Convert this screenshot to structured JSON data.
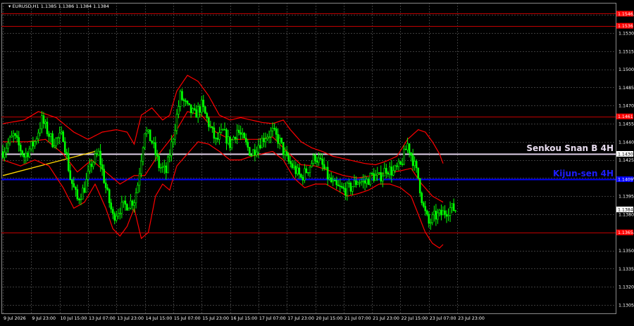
{
  "header": {
    "symbol": "EURUSD,H1",
    "ohlc": "1.1385 1.1386 1.1384 1.1384"
  },
  "colors": {
    "background": "#000000",
    "grid": "#3c3c3c",
    "candle": "#00ff00",
    "bollinger": "#ff0000",
    "resistance": "#c00000",
    "senkou": "#e0d0e8",
    "kijun": "#0000ff",
    "trendline": "#ffd700",
    "axis_text": "#ffffff",
    "price_label_bg": "#ffffff",
    "red_label_bg": "#ff0000"
  },
  "chart_data": {
    "type": "candlestick",
    "title": "",
    "ylim": [
      1.1298,
      1.1555
    ],
    "y_ticks": [
      "1.1545",
      "1.1530",
      "1.1515",
      "1.1500",
      "1.1485",
      "1.1470",
      "1.1455",
      "1.1440",
      "1.1425",
      "1.1410",
      "1.1395",
      "1.1380",
      "1.1365",
      "1.1350",
      "1.1335",
      "1.1320",
      "1.1305"
    ],
    "x_ticks": [
      "9 Jul 2026",
      "9 Jul 23:00",
      "10 Jul 15:00",
      "13 Jul 07:00",
      "13 Jul 23:00",
      "14 Jul 15:00",
      "15 Jul 07:00",
      "15 Jul 23:00",
      "16 Jul 15:00",
      "17 Jul 07:00",
      "17 Jul 23:00",
      "20 Jul 15:00",
      "21 Jul 07:00",
      "21 Jul 23:00",
      "22 Jul 15:00",
      "23 Jul 07:00",
      "23 Jul 23:00"
    ],
    "total_bars": 256,
    "current_price": 1.1384,
    "current_price_label": "1.1384",
    "levels": [
      {
        "price": 1.1546,
        "label": "1.1546",
        "kind": "resistance"
      },
      {
        "price": 1.1536,
        "label": "1.1536",
        "kind": "resistance"
      },
      {
        "price": 1.1461,
        "label": "1.1461",
        "kind": "resistance"
      },
      {
        "price": 1.143,
        "label": "1.1430",
        "kind": "senkou"
      },
      {
        "price": 1.1409,
        "label": "1.1409",
        "kind": "kijun"
      },
      {
        "price": 1.1365,
        "label": "1.1365",
        "kind": "resistance"
      }
    ],
    "annotations": [
      {
        "text": "Senkou Snan B 4H",
        "price": 1.143,
        "color": "#e8dcef"
      },
      {
        "text": "Kijun-sen 4H",
        "price": 1.1409,
        "color": "#1e1eff"
      }
    ],
    "trendline": {
      "from": {
        "bar": 0,
        "price": 1.1412
      },
      "to": {
        "bar": 52,
        "price": 1.1432
      }
    },
    "price_path": [
      [
        0,
        1.1432
      ],
      [
        6,
        1.1445
      ],
      [
        12,
        1.1428
      ],
      [
        18,
        1.144
      ],
      [
        22,
        1.1458
      ],
      [
        28,
        1.144
      ],
      [
        34,
        1.1445
      ],
      [
        38,
        1.141
      ],
      [
        42,
        1.1392
      ],
      [
        46,
        1.1402
      ],
      [
        50,
        1.1422
      ],
      [
        54,
        1.143
      ],
      [
        58,
        1.1402
      ],
      [
        62,
        1.1378
      ],
      [
        66,
        1.1385
      ],
      [
        70,
        1.1388
      ],
      [
        74,
        1.1392
      ],
      [
        76,
        1.1405
      ],
      [
        80,
        1.145
      ],
      [
        84,
        1.144
      ],
      [
        88,
        1.142
      ],
      [
        92,
        1.1415
      ],
      [
        96,
        1.1445
      ],
      [
        100,
        1.1478
      ],
      [
        104,
        1.1468
      ],
      [
        108,
        1.1462
      ],
      [
        112,
        1.147
      ],
      [
        116,
        1.1455
      ],
      [
        120,
        1.144
      ],
      [
        124,
        1.1448
      ],
      [
        128,
        1.1438
      ],
      [
        132,
        1.145
      ],
      [
        136,
        1.144
      ],
      [
        140,
        1.143
      ],
      [
        144,
        1.1438
      ],
      [
        148,
        1.1445
      ],
      [
        152,
        1.1448
      ],
      [
        156,
        1.144
      ],
      [
        160,
        1.1425
      ],
      [
        164,
        1.1418
      ],
      [
        168,
        1.141
      ],
      [
        172,
        1.1418
      ],
      [
        176,
        1.1428
      ],
      [
        180,
        1.142
      ],
      [
        184,
        1.1408
      ],
      [
        188,
        1.1402
      ],
      [
        192,
        1.14
      ],
      [
        196,
        1.1402
      ],
      [
        200,
        1.1408
      ],
      [
        204,
        1.1406
      ],
      [
        208,
        1.1412
      ],
      [
        212,
        1.141
      ],
      [
        216,
        1.1418
      ],
      [
        220,
        1.1415
      ],
      [
        224,
        1.142
      ],
      [
        228,
        1.1438
      ],
      [
        231,
        1.1425
      ],
      [
        234,
        1.141
      ],
      [
        237,
        1.1385
      ],
      [
        240,
        1.1372
      ],
      [
        243,
        1.1378
      ],
      [
        247,
        1.138
      ],
      [
        252,
        1.1385
      ],
      [
        255,
        1.1384
      ]
    ],
    "bollinger_upper": [
      [
        0,
        1.1455
      ],
      [
        12,
        1.1458
      ],
      [
        20,
        1.1465
      ],
      [
        30,
        1.146
      ],
      [
        40,
        1.1448
      ],
      [
        48,
        1.1442
      ],
      [
        56,
        1.1448
      ],
      [
        64,
        1.145
      ],
      [
        70,
        1.1448
      ],
      [
        74,
        1.1438
      ],
      [
        78,
        1.1462
      ],
      [
        84,
        1.1468
      ],
      [
        90,
        1.1458
      ],
      [
        94,
        1.1462
      ],
      [
        98,
        1.1482
      ],
      [
        104,
        1.1495
      ],
      [
        110,
        1.149
      ],
      [
        116,
        1.1478
      ],
      [
        122,
        1.1462
      ],
      [
        128,
        1.1458
      ],
      [
        134,
        1.146
      ],
      [
        140,
        1.1458
      ],
      [
        146,
        1.1456
      ],
      [
        152,
        1.1455
      ],
      [
        158,
        1.1458
      ],
      [
        162,
        1.145
      ],
      [
        168,
        1.144
      ],
      [
        174,
        1.1435
      ],
      [
        180,
        1.1432
      ],
      [
        186,
        1.1428
      ],
      [
        192,
        1.1426
      ],
      [
        198,
        1.1424
      ],
      [
        204,
        1.1422
      ],
      [
        210,
        1.1421
      ],
      [
        216,
        1.1424
      ],
      [
        222,
        1.1428
      ],
      [
        228,
        1.1442
      ],
      [
        234,
        1.145
      ],
      [
        238,
        1.1448
      ],
      [
        242,
        1.144
      ],
      [
        246,
        1.143
      ],
      [
        248,
        1.1422
      ]
    ],
    "bollinger_lower": [
      [
        0,
        1.1425
      ],
      [
        10,
        1.142
      ],
      [
        18,
        1.1425
      ],
      [
        26,
        1.142
      ],
      [
        34,
        1.1402
      ],
      [
        40,
        1.1385
      ],
      [
        46,
        1.139
      ],
      [
        52,
        1.1405
      ],
      [
        58,
        1.1385
      ],
      [
        62,
        1.1368
      ],
      [
        66,
        1.1362
      ],
      [
        70,
        1.137
      ],
      [
        74,
        1.1385
      ],
      [
        78,
        1.136
      ],
      [
        82,
        1.1365
      ],
      [
        86,
        1.1395
      ],
      [
        90,
        1.1405
      ],
      [
        94,
        1.14
      ],
      [
        98,
        1.142
      ],
      [
        104,
        1.143
      ],
      [
        110,
        1.144
      ],
      [
        116,
        1.1438
      ],
      [
        122,
        1.1432
      ],
      [
        128,
        1.1425
      ],
      [
        134,
        1.1425
      ],
      [
        140,
        1.1428
      ],
      [
        146,
        1.143
      ],
      [
        152,
        1.1432
      ],
      [
        158,
        1.1425
      ],
      [
        164,
        1.141
      ],
      [
        170,
        1.1402
      ],
      [
        176,
        1.1405
      ],
      [
        182,
        1.1405
      ],
      [
        188,
        1.14
      ],
      [
        194,
        1.1395
      ],
      [
        200,
        1.1397
      ],
      [
        206,
        1.14
      ],
      [
        212,
        1.1405
      ],
      [
        218,
        1.1405
      ],
      [
        224,
        1.1402
      ],
      [
        230,
        1.1395
      ],
      [
        234,
        1.138
      ],
      [
        238,
        1.1365
      ],
      [
        242,
        1.1356
      ],
      [
        246,
        1.1352
      ],
      [
        248,
        1.1355
      ]
    ],
    "bollinger_middle": [
      [
        0,
        1.144
      ],
      [
        14,
        1.144
      ],
      [
        24,
        1.1442
      ],
      [
        34,
        1.143
      ],
      [
        42,
        1.1415
      ],
      [
        50,
        1.1425
      ],
      [
        58,
        1.1415
      ],
      [
        66,
        1.1405
      ],
      [
        74,
        1.1412
      ],
      [
        80,
        1.1412
      ],
      [
        88,
        1.143
      ],
      [
        96,
        1.1445
      ],
      [
        104,
        1.1465
      ],
      [
        112,
        1.1462
      ],
      [
        120,
        1.1448
      ],
      [
        128,
        1.1442
      ],
      [
        136,
        1.1442
      ],
      [
        144,
        1.1442
      ],
      [
        152,
        1.1444
      ],
      [
        160,
        1.1432
      ],
      [
        168,
        1.1421
      ],
      [
        176,
        1.142
      ],
      [
        184,
        1.1416
      ],
      [
        192,
        1.1412
      ],
      [
        200,
        1.141
      ],
      [
        208,
        1.1412
      ],
      [
        216,
        1.1414
      ],
      [
        224,
        1.1416
      ],
      [
        230,
        1.1418
      ],
      [
        236,
        1.1405
      ],
      [
        242,
        1.1395
      ],
      [
        248,
        1.139
      ]
    ]
  }
}
